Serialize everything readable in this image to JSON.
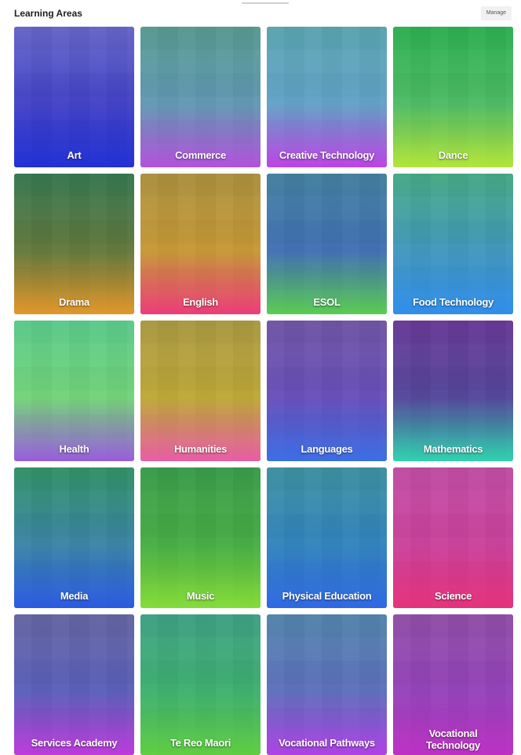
{
  "header": {
    "title": "Learning Areas",
    "manage_label": "Manage"
  },
  "tiles": [
    {
      "label": "Art",
      "colors": [
        "#6b6be0",
        "#3a3ad8",
        "#1f2fd8"
      ],
      "photo": "#5a5a8a"
    },
    {
      "label": "Commerce",
      "colors": [
        "#4fa8a0",
        "#5fa0c8",
        "#b54fe0"
      ],
      "photo": "#6a7a6a"
    },
    {
      "label": "Creative Technology",
      "colors": [
        "#4fb0c0",
        "#5aa8d8",
        "#c040e8"
      ],
      "photo": "#7a8a8a"
    },
    {
      "label": "Dance",
      "colors": [
        "#2ebf5a",
        "#58c870",
        "#b8e83a"
      ],
      "photo": "#2a8a3a"
    },
    {
      "label": "Drama",
      "colors": [
        "#2f8f60",
        "#6a8a40",
        "#e89a2a"
      ],
      "photo": "#4a3a2a"
    },
    {
      "label": "English",
      "colors": [
        "#b89a3a",
        "#d8a030",
        "#f03a7a"
      ],
      "photo": "#8a7a4a"
    },
    {
      "label": "ESOL",
      "colors": [
        "#3a8aa8",
        "#3a70c0",
        "#5acf50"
      ],
      "photo": "#5a6a8a"
    },
    {
      "label": "Food Technology",
      "colors": [
        "#3fb888",
        "#3a9ad0",
        "#2e8ef0"
      ],
      "photo": "#5a8a7a"
    },
    {
      "label": "Health",
      "colors": [
        "#4fd08a",
        "#70d870",
        "#9a58e0"
      ],
      "photo": "#7ac090"
    },
    {
      "label": "Humanities",
      "colors": [
        "#b0a040",
        "#c8b030",
        "#ec5aa8"
      ],
      "photo": "#9a8a4a"
    },
    {
      "label": "Languages",
      "colors": [
        "#7a5ab0",
        "#6a50c8",
        "#3a70e8"
      ],
      "photo": "#5a4a8a"
    },
    {
      "label": "Mathematics",
      "colors": [
        "#7a3aa8",
        "#5a4aa8",
        "#30d8b0"
      ],
      "photo": "#3a3a6a"
    },
    {
      "label": "Media",
      "colors": [
        "#2fa870",
        "#3a90c0",
        "#2a5ae8"
      ],
      "photo": "#3a5a4a"
    },
    {
      "label": "Music",
      "colors": [
        "#3ab050",
        "#4ac048",
        "#88e038"
      ],
      "photo": "#3a6a3a"
    },
    {
      "label": "Physical Education",
      "colors": [
        "#3aa0b0",
        "#2a8ad0",
        "#2e68e8"
      ],
      "photo": "#4a6a7a"
    },
    {
      "label": "Science",
      "colors": [
        "#d04ab0",
        "#d83aa0",
        "#e8307a"
      ],
      "photo": "#9a5a8a"
    },
    {
      "label": "Services Academy",
      "colors": [
        "#6a6ab8",
        "#5a60d0",
        "#c03ae0"
      ],
      "photo": "#5a5a6a"
    },
    {
      "label": "Te Reo Maori",
      "colors": [
        "#3ab090",
        "#3abf70",
        "#60d040"
      ],
      "photo": "#4a7a6a"
    },
    {
      "label": "Vocational Pathways",
      "colors": [
        "#4a90c0",
        "#5a70d0",
        "#b040e8"
      ],
      "photo": "#6a6a7a"
    },
    {
      "label": "Vocational Technology",
      "colors": [
        "#a050c0",
        "#a040d0",
        "#c030c8"
      ],
      "photo": "#6a4a6a"
    }
  ]
}
